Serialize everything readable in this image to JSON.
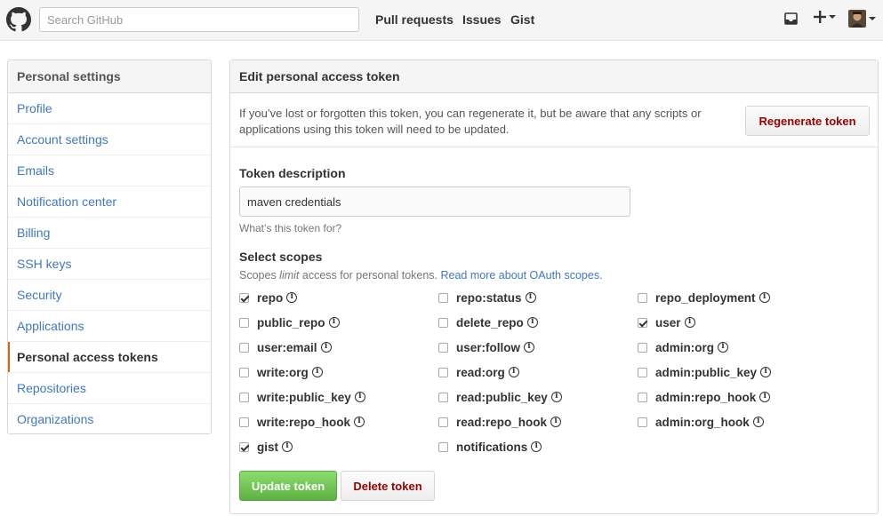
{
  "header": {
    "search_placeholder": "Search GitHub",
    "nav": [
      "Pull requests",
      "Issues",
      "Gist"
    ],
    "icons": [
      "octocat-logo-icon",
      "inbox-icon",
      "plus-icon",
      "avatar"
    ]
  },
  "sidebar": {
    "title": "Personal settings",
    "items": [
      {
        "label": "Profile"
      },
      {
        "label": "Account settings"
      },
      {
        "label": "Emails"
      },
      {
        "label": "Notification center"
      },
      {
        "label": "Billing"
      },
      {
        "label": "SSH keys"
      },
      {
        "label": "Security"
      },
      {
        "label": "Applications"
      },
      {
        "label": "Personal access tokens",
        "active": true
      },
      {
        "label": "Repositories"
      },
      {
        "label": "Organizations"
      }
    ]
  },
  "main": {
    "title": "Edit personal access token",
    "regenerate_text": "If you’ve lost or forgotten this token, you can regenerate it, but be aware that any scripts or applications using this token will need to be updated.",
    "regenerate_button": "Regenerate token",
    "token_description_label": "Token description",
    "token_description_value": "maven credentials",
    "token_description_note": "What’s this token for?",
    "scopes_label": "Select scopes",
    "scopes_note_prefix": "Scopes ",
    "scopes_note_em": "limit",
    "scopes_note_suffix": " access for personal tokens. ",
    "scopes_link": "Read more about OAuth scopes.",
    "scopes": [
      {
        "name": "repo",
        "checked": true
      },
      {
        "name": "repo:status",
        "checked": false
      },
      {
        "name": "repo_deployment",
        "checked": false
      },
      {
        "name": "public_repo",
        "checked": false
      },
      {
        "name": "delete_repo",
        "checked": false
      },
      {
        "name": "user",
        "checked": true
      },
      {
        "name": "user:email",
        "checked": false
      },
      {
        "name": "user:follow",
        "checked": false
      },
      {
        "name": "admin:org",
        "checked": false
      },
      {
        "name": "write:org",
        "checked": false
      },
      {
        "name": "read:org",
        "checked": false
      },
      {
        "name": "admin:public_key",
        "checked": false
      },
      {
        "name": "write:public_key",
        "checked": false
      },
      {
        "name": "read:public_key",
        "checked": false
      },
      {
        "name": "admin:repo_hook",
        "checked": false
      },
      {
        "name": "write:repo_hook",
        "checked": false
      },
      {
        "name": "read:repo_hook",
        "checked": false
      },
      {
        "name": "admin:org_hook",
        "checked": false
      },
      {
        "name": "gist",
        "checked": true
      },
      {
        "name": "notifications",
        "checked": false
      }
    ],
    "update_button": "Update token",
    "delete_button": "Delete token"
  },
  "colors": {
    "link": "#4078c0",
    "active_marker": "#d26911",
    "primary_button": "#60b044",
    "danger_text": "#990000"
  }
}
